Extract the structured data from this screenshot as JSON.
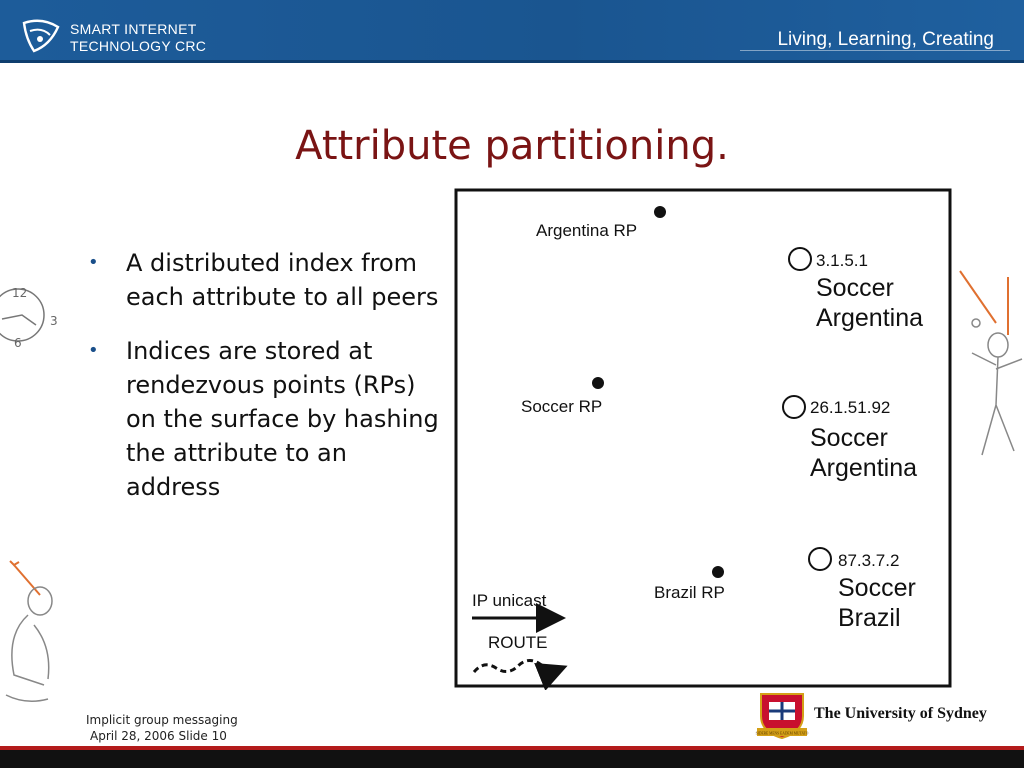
{
  "header": {
    "brand_line1": "SMART INTERNET",
    "brand_line2": "TECHNOLOGY CRC",
    "tagline": "Living, Learning, Creating"
  },
  "slide": {
    "title": "Attribute partitioning.",
    "bullets": [
      "A distributed index from each attribute to all peers",
      "Indices are stored at rendezvous points (RPs) on the surface by hashing the attribute to an address"
    ]
  },
  "diagram": {
    "rps": [
      "Argentina RP",
      "Soccer RP",
      "Brazil RP"
    ],
    "peers": [
      {
        "ip": "3.1.5.1",
        "line1": "Soccer",
        "line2": "Argentina"
      },
      {
        "ip": "26.1.51.92",
        "line1": "Soccer",
        "line2": "Argentina"
      },
      {
        "ip": "87.3.7.2",
        "line1": "Soccer",
        "line2": "Brazil"
      }
    ],
    "legend": {
      "unicast": "IP unicast",
      "route": "ROUTE"
    }
  },
  "sketch": {
    "clock_numerals": [
      "12",
      "3",
      "6"
    ]
  },
  "footer": {
    "line1": "Implicit group messaging",
    "line2": "April 28, 2006 Slide 10",
    "university": "The University of Sydney",
    "crest_motto": "SIDERE MENS EADEM MUTATO"
  },
  "colors": {
    "header": "#1d5c9a",
    "title": "#7a1414",
    "footer_accent": "#b31b1b"
  }
}
